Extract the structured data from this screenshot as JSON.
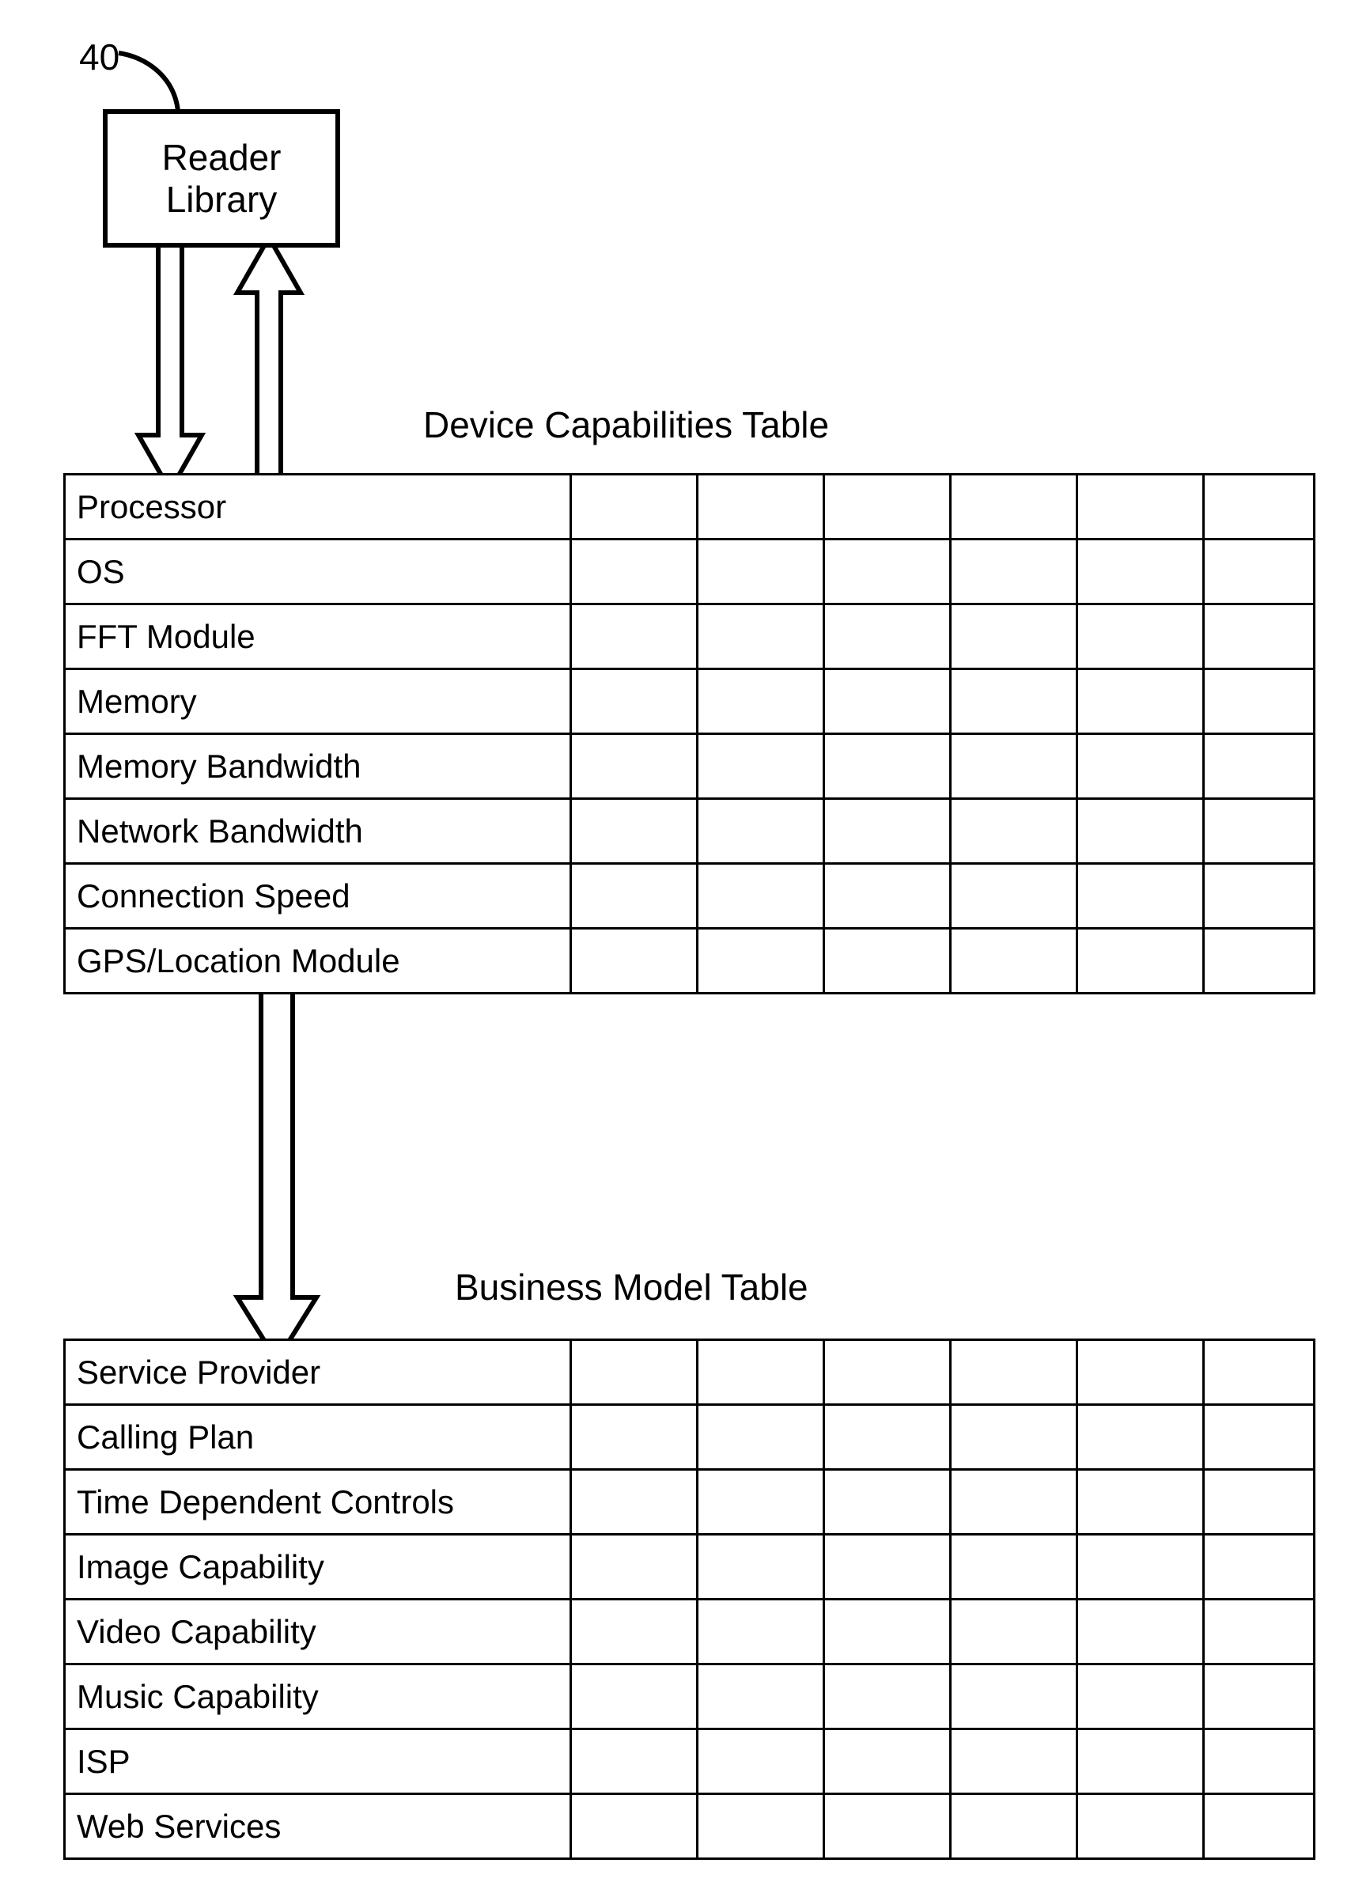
{
  "ref_number": "40",
  "reader_box": "Reader\nLibrary",
  "titles": {
    "device_caps": "Device Capabilities Table",
    "biz_model": "Business Model Table"
  },
  "device_caps_rows": [
    "Processor",
    "OS",
    "FFT Module",
    "Memory",
    "Memory Bandwidth",
    "Network Bandwidth",
    "Connection Speed",
    "GPS/Location Module"
  ],
  "biz_model_rows": [
    "Service Provider",
    "Calling Plan",
    "Time Dependent Controls",
    "Image Capability",
    "Video Capability",
    "Music Capability",
    "ISP",
    "Web Services"
  ]
}
